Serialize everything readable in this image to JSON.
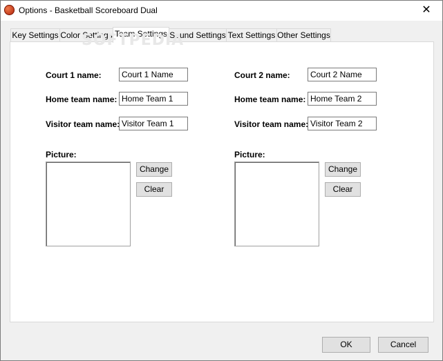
{
  "window": {
    "title": "Options - Basketball Scoreboard Dual",
    "close_glyph": "✕"
  },
  "tabs": [
    {
      "label": "Key Settings"
    },
    {
      "label": "Color Settings"
    },
    {
      "label": "Team Settings"
    },
    {
      "label": "Sound Settings"
    },
    {
      "label": "Text Settings"
    },
    {
      "label": "Other Settings"
    }
  ],
  "active_tab": "Team Settings",
  "watermark": "SOFTPEDIA",
  "court1": {
    "court_label": "Court  1 name:",
    "court_value": "Court 1 Name",
    "home_label": "Home team name:",
    "home_value": "Home Team 1",
    "visitor_label": "Visitor team name:",
    "visitor_value": "Visitor Team 1",
    "picture_label": "Picture:",
    "change_label": "Change",
    "clear_label": "Clear"
  },
  "court2": {
    "court_label": "Court  2 name:",
    "court_value": "Court 2 Name",
    "home_label": "Home team name:",
    "home_value": "Home Team 2",
    "visitor_label": "Visitor team name:",
    "visitor_value": "Visitor Team 2",
    "picture_label": "Picture:",
    "change_label": "Change",
    "clear_label": "Clear"
  },
  "footer": {
    "ok_label": "OK",
    "cancel_label": "Cancel"
  }
}
